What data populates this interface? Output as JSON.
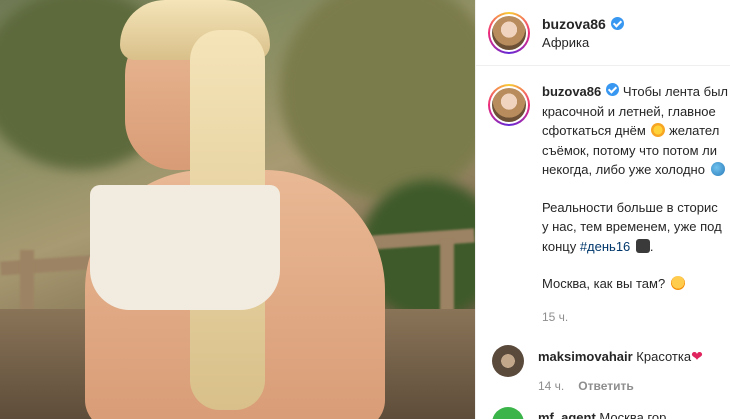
{
  "header": {
    "username": "buzova86",
    "location": "Африка"
  },
  "caption": {
    "username": "buzova86",
    "lines": [
      "Чтобы лента был",
      "красочной и летней, главное",
      "сфоткаться днём",
      "желател",
      "съёмок, потому что потом ли",
      "некогда, либо уже холодно",
      "",
      "Реальности больше в сторис",
      "у нас, тем временем, уже под",
      "концу",
      "#день16",
      "",
      "Москва, как вы там?"
    ],
    "time": "15 ч."
  },
  "comments": [
    {
      "username": "maksimovahair",
      "text": "Красотка",
      "time": "14 ч.",
      "reply": "Ответить"
    },
    {
      "username": "mf_agent",
      "text": "Москва гор"
    }
  ],
  "icons": {
    "verified": "verified-badge-icon",
    "heart": "heart-icon"
  },
  "colors": {
    "verified": "#3897f0",
    "hashtag": "#00376b",
    "muted": "#8e8e8e",
    "heart": "#e0245e"
  }
}
